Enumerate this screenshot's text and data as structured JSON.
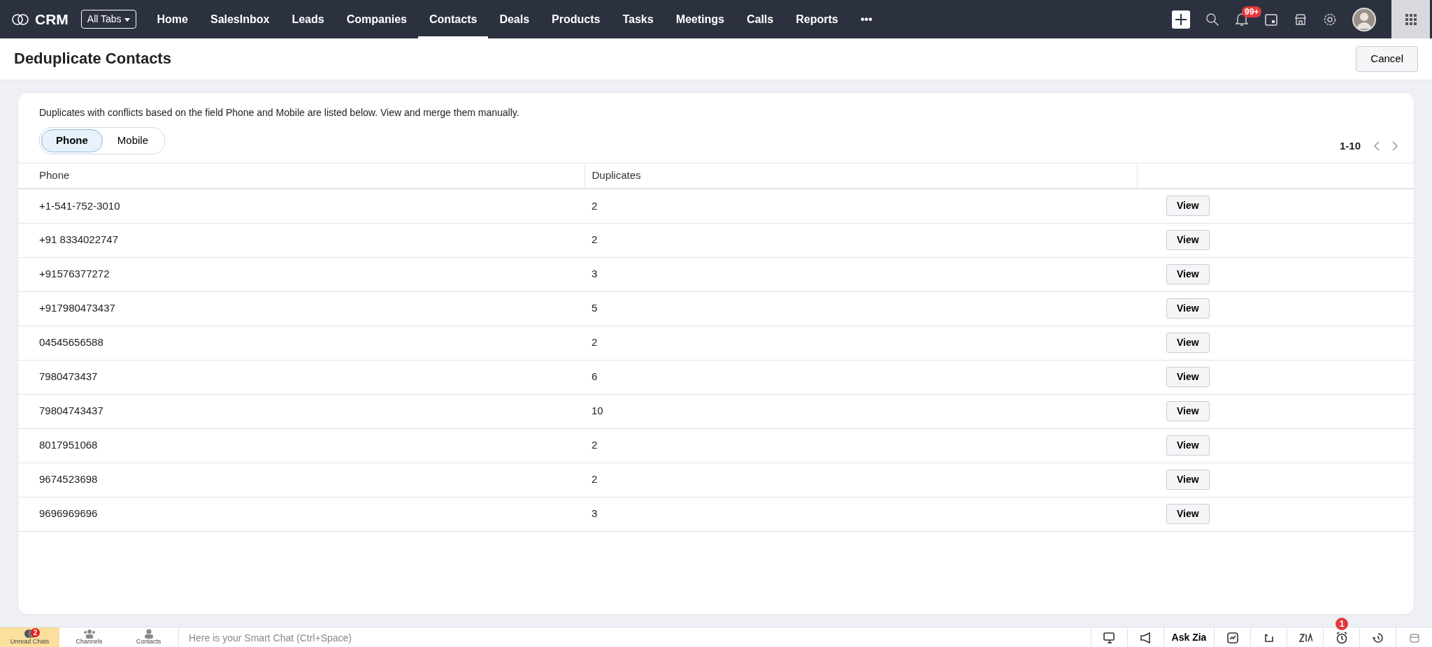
{
  "nav": {
    "brand": "CRM",
    "all_tabs": "All Tabs",
    "tabs": [
      {
        "label": "Home",
        "selected": false
      },
      {
        "label": "SalesInbox",
        "selected": false
      },
      {
        "label": "Leads",
        "selected": false
      },
      {
        "label": "Companies",
        "selected": false
      },
      {
        "label": "Contacts",
        "selected": true
      },
      {
        "label": "Deals",
        "selected": false
      },
      {
        "label": "Products",
        "selected": false
      },
      {
        "label": "Tasks",
        "selected": false
      },
      {
        "label": "Meetings",
        "selected": false
      },
      {
        "label": "Calls",
        "selected": false
      },
      {
        "label": "Reports",
        "selected": false
      }
    ],
    "more": "•••",
    "notification_count": "99+"
  },
  "header": {
    "title": "Deduplicate Contacts",
    "cancel": "Cancel"
  },
  "panel": {
    "description": "Duplicates with conflicts based on the field Phone and Mobile are listed below. View and merge them manually.",
    "toggle": [
      {
        "label": "Phone",
        "selected": true
      },
      {
        "label": "Mobile",
        "selected": false
      }
    ],
    "pagination": "1-10",
    "columns": [
      "Phone",
      "Duplicates"
    ],
    "rows": [
      {
        "phone": "+1-541-752-3010",
        "duplicates": "2",
        "action": "View"
      },
      {
        "phone": "+91 8334022747",
        "duplicates": "2",
        "action": "View"
      },
      {
        "phone": "+91576377272",
        "duplicates": "3",
        "action": "View"
      },
      {
        "phone": "+917980473437",
        "duplicates": "5",
        "action": "View"
      },
      {
        "phone": "04545656588",
        "duplicates": "2",
        "action": "View"
      },
      {
        "phone": "7980473437",
        "duplicates": "6",
        "action": "View"
      },
      {
        "phone": "79804743437",
        "duplicates": "10",
        "action": "View"
      },
      {
        "phone": "8017951068",
        "duplicates": "2",
        "action": "View"
      },
      {
        "phone": "9674523698",
        "duplicates": "2",
        "action": "View"
      },
      {
        "phone": "9696969696",
        "duplicates": "3",
        "action": "View"
      }
    ]
  },
  "bottom_bar": {
    "tabs": [
      {
        "label": "Unread Chats",
        "selected": true,
        "badge": "2"
      },
      {
        "label": "Channels",
        "selected": false
      },
      {
        "label": "Contacts",
        "selected": false
      }
    ],
    "chat_placeholder": "Here is your Smart Chat (Ctrl+Space)",
    "ask_zia": "Ask Zia",
    "reminder_badge": "1"
  }
}
